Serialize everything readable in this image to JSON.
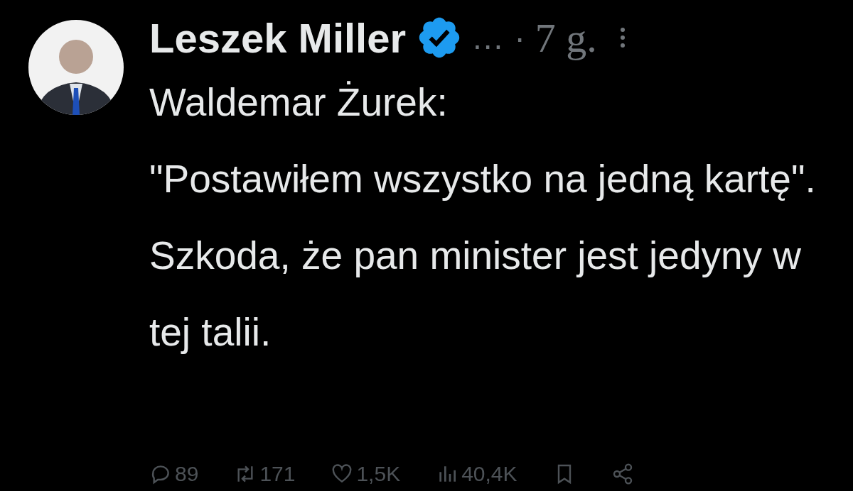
{
  "author": {
    "name": "Leszek Miller",
    "verified": true,
    "ellipsis": "...",
    "separator": "·",
    "time": "7 g."
  },
  "text": "Waldemar Żurek:\n\"Postawiłem wszystko na jedną kartę\". Szkoda, że pan minister jest jedyny w tej talii.",
  "actions": [
    {
      "kind": "reply",
      "count": "89"
    },
    {
      "kind": "repost",
      "count": "171"
    },
    {
      "kind": "like",
      "count": "1,5K"
    },
    {
      "kind": "views",
      "count": "40,4K"
    },
    {
      "kind": "bookmark"
    },
    {
      "kind": "share"
    }
  ]
}
